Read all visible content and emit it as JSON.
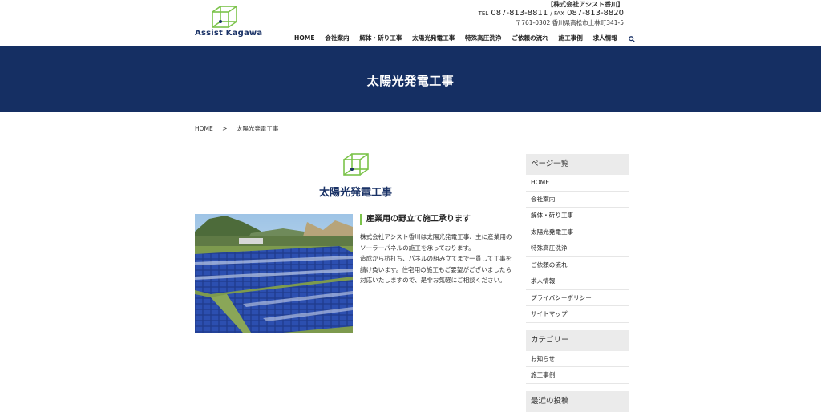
{
  "header": {
    "logo_text": "Assist Kagawa",
    "company": "【株式会社アシスト香川】",
    "tel_label": "TEL",
    "tel": "087-813-8811",
    "fax_label": "/ FAX",
    "fax": "087-813-8820",
    "address": "〒761-0302 香川県高松市上林町341-5"
  },
  "nav": {
    "items": [
      "HOME",
      "会社案内",
      "解体・斫り工事",
      "太陽光発電工事",
      "特殊高圧洗浄",
      "ご依頼の流れ",
      "施工事例",
      "求人情報"
    ],
    "search_icon": "search-icon"
  },
  "banner": {
    "title": "太陽光発電工事"
  },
  "breadcrumb": {
    "home": "HOME",
    "separator": ">",
    "current": "太陽光発電工事"
  },
  "section": {
    "title": "太陽光発電工事",
    "icon": "cube-icon",
    "heading": "産業用の野立て施工承ります",
    "paragraphs": [
      "株式会社アシスト香川は太陽光発電工事、主に産業用のソーラーパネルの施工を承っております。",
      "造成から杭打ち、パネルの組み立てまで一貫して工事を請け負います。住宅用の施工もご要望がございましたら対応いたしますので、是非お気軽にご相談ください。"
    ]
  },
  "sidebar": {
    "pages_title": "ページ一覧",
    "pages": [
      "HOME",
      "会社案内",
      "解体・斫り工事",
      "太陽光発電工事",
      "特殊高圧洗浄",
      "ご依頼の流れ",
      "求人情報",
      "プライバシーポリシー",
      "サイトマップ"
    ],
    "category_title": "カテゴリー",
    "categories": [
      "お知らせ",
      "施工事例"
    ],
    "recent_title": "最近の投稿"
  },
  "colors": {
    "navy": "#152f63",
    "accent_green": "#7bc34a",
    "title_blue": "#1a3266"
  }
}
